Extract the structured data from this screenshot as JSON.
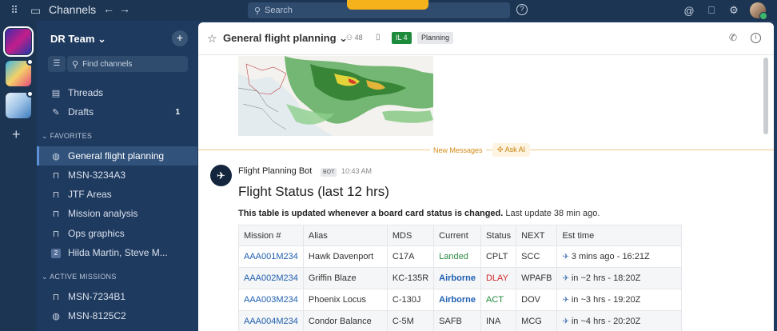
{
  "topbar": {
    "brand": "Channels",
    "search_placeholder": "Search"
  },
  "sidebar": {
    "team_name": "DR Team ⌄",
    "find_placeholder": "Find channels",
    "threads": "Threads",
    "drafts": "Drafts",
    "drafts_count": "1",
    "favorites_header": "⌄ FAVORITES",
    "favorites": [
      {
        "label": "General flight planning"
      },
      {
        "label": "MSN-3234A3"
      },
      {
        "label": "JTF Areas"
      },
      {
        "label": "Mission analysis"
      },
      {
        "label": "Ops graphics"
      },
      {
        "label": "Hilda Martin, Steve M...",
        "dm_count": "2"
      }
    ],
    "active_header": "⌄ ACTIVE MISSIONS",
    "active_missions": [
      {
        "label": "MSN-7234B1"
      },
      {
        "label": "MSN-8125C2"
      }
    ]
  },
  "channel": {
    "title": "General flight planning ⌄",
    "members": "48",
    "il_badge": "IL 4",
    "tag": "Planning"
  },
  "messages": {
    "new_messages": "New Messages",
    "ask_ai": "Ask AI",
    "bot_name": "Flight Planning Bot",
    "bot_tag": "BOT",
    "time": "10:43 AM",
    "title": "Flight Status (last 12 hrs)",
    "text_bold": "This table is updated whenever a board card status is changed.",
    "text_rest": " Last update 38 min ago."
  },
  "table": {
    "headers": [
      "Mission #",
      "Alias",
      "MDS",
      "Current",
      "Status",
      "NEXT",
      "Est time"
    ],
    "rows": [
      {
        "mission": "AAA001M234",
        "alias": "Hawk Davenport",
        "mds": "C17A",
        "current": "Landed",
        "status": "CPLT",
        "next": "SCC",
        "est": "3 mins ago - 16:21Z"
      },
      {
        "mission": "AAA002M234",
        "alias": "Griffin Blaze",
        "mds": "KC-135R",
        "current": "Airborne",
        "status": "DLAY",
        "next": "WPAFB",
        "est": "in ~2 hrs - 18:20Z"
      },
      {
        "mission": "AAA003M234",
        "alias": "Phoenix Locus",
        "mds": "C-130J",
        "current": "Airborne",
        "status": "ACT",
        "next": "DOV",
        "est": "in ~3 hrs - 19:20Z"
      },
      {
        "mission": "AAA004M234",
        "alias": "Condor Balance",
        "mds": "C-5M",
        "current": "SAFB",
        "status": "INA",
        "next": "MCG",
        "est": "in ~4 hrs - 20:20Z"
      }
    ]
  }
}
